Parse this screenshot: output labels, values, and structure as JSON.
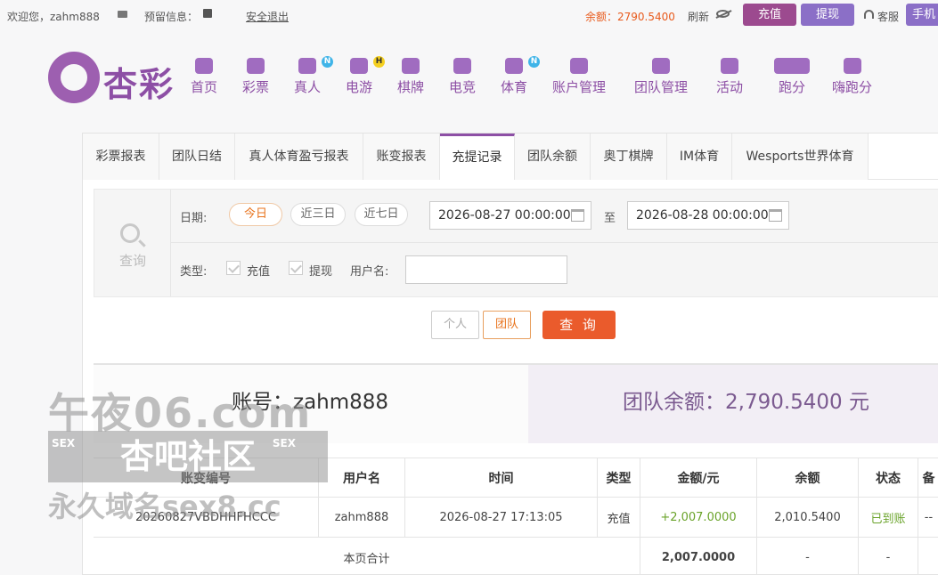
{
  "topbar": {
    "welcome": "欢迎您，zahm888",
    "reserved_info": "预留信息：",
    "logout": "安全退出",
    "balance": "余额：2790.5400",
    "refresh": "刷新",
    "charge": "充值",
    "withdraw": "提现",
    "service": "客服",
    "mobile": "手机"
  },
  "logo": {
    "text": "杏彩"
  },
  "nav": [
    {
      "label": "首页",
      "icon": "home-icon"
    },
    {
      "label": "彩票",
      "icon": "ticket-icon"
    },
    {
      "label": "真人",
      "icon": "dealer-icon",
      "badge": "N"
    },
    {
      "label": "电游",
      "icon": "gamepad-icon",
      "badge": "H"
    },
    {
      "label": "棋牌",
      "icon": "cards-icon"
    },
    {
      "label": "电竞",
      "icon": "esports-icon"
    },
    {
      "label": "体育",
      "icon": "trophy-icon",
      "badge": "N"
    },
    {
      "label": "账户管理",
      "icon": "yen-icon"
    },
    {
      "label": "团队管理",
      "icon": "team-icon"
    },
    {
      "label": "活动",
      "icon": "gift-icon"
    },
    {
      "label": "跑分",
      "icon": "run-icon"
    },
    {
      "label": "嗨跑分",
      "icon": "hi-icon"
    }
  ],
  "tabs": [
    "彩票报表",
    "团队日结",
    "真人体育盈亏报表",
    "账变报表",
    "充提记录",
    "团队余额",
    "奥丁棋牌",
    "IM体育",
    "Wesports世界体育"
  ],
  "active_tab": "充提记录",
  "query": {
    "side_label": "查询",
    "date_label": "日期:",
    "today": "今日",
    "three_days": "近三日",
    "seven_days": "近七日",
    "date_from": "2026-08-27 00:00:00",
    "to_label": "至",
    "date_to": "2026-08-28 00:00:00",
    "type_label": "类型:",
    "type_charge": "充值",
    "type_withdraw": "提现",
    "username_label": "用户名:",
    "username_value": ""
  },
  "buttons": {
    "personal": "个人",
    "team": "团队",
    "search": "查 询"
  },
  "summary": {
    "account": "账号：zahm888",
    "team_balance": "团队余额：2,790.5400 元"
  },
  "table": {
    "headers": [
      "账变编号",
      "用户名",
      "时间",
      "类型",
      "金额/元",
      "余额",
      "状态",
      "备"
    ],
    "rows": [
      [
        "20260827VBDHHFHCCC",
        "zahm888",
        "2026-08-27 17:13:05",
        "充值",
        "+2,007.0000",
        "2,010.5400",
        "已到账",
        "--"
      ]
    ],
    "total": {
      "label": "本页合计",
      "amount": "2,007.0000",
      "balance": "-",
      "status": "-"
    }
  },
  "watermark": {
    "line1": "午夜06.com",
    "line2": "杏吧社区",
    "sex": "SEX",
    "line3": "永久域名sex8.cc"
  },
  "colors": {
    "brand": "#8d4fa5",
    "accent": "#ea5b2c",
    "balance": "#e85a1c",
    "success": "#6aa32a"
  }
}
